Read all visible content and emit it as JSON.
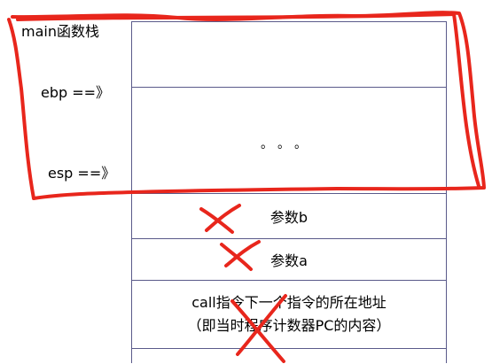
{
  "title": "main函数栈",
  "pointers": {
    "ebp": "ebp ==》",
    "esp": "esp ==》"
  },
  "cells": {
    "top": "",
    "dots": "。。。",
    "param_b": "参数b",
    "param_a": "参数a",
    "return_line1": "call指令下一个指令的所在地址",
    "return_line2": "（即当时程序计数器PC的内容）",
    "bottom": ""
  },
  "annotation_color": "#e8261c"
}
